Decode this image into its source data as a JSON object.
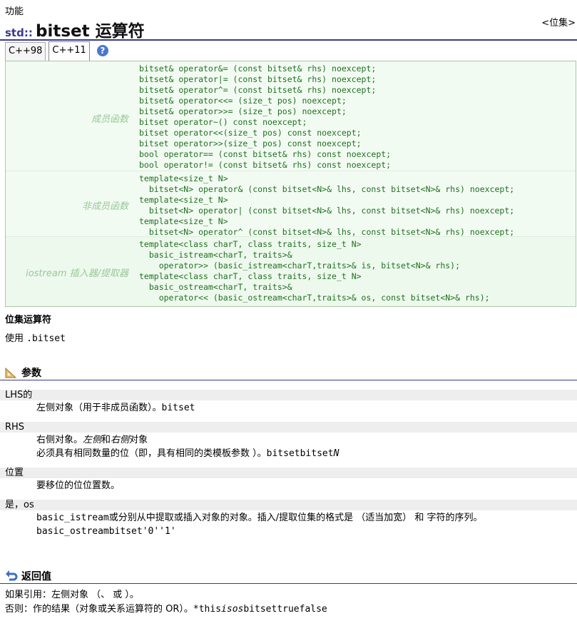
{
  "top_label": "功能",
  "header_link": "<位集>",
  "title": {
    "ns": "std::",
    "main": "bitset 运算符"
  },
  "tabs": [
    {
      "label": "C++98"
    },
    {
      "label": "C++11"
    }
  ],
  "help_icon_glyph": "?",
  "declarations": {
    "members": {
      "label": "成员函数",
      "lines": [
        "bitset& operator&= (const bitset& rhs) noexcept;",
        "bitset& operator|= (const bitset& rhs) noexcept;",
        "bitset& operator^= (const bitset& rhs) noexcept;",
        "bitset& operator<<= (size_t pos) noexcept;",
        "bitset& operator>>= (size_t pos) noexcept;",
        "bitset operator~() const noexcept;",
        "bitset operator<<(size_t pos) const noexcept;",
        "bitset operator>>(size_t pos) const noexcept;",
        "bool operator== (const bitset& rhs) const noexcept;",
        "bool operator!= (const bitset& rhs) const noexcept;"
      ]
    },
    "non_members": {
      "label": "非成员函数",
      "lines": [
        "template<size_t N>",
        "  bitset<N> operator& (const bitset<N>& lhs, const bitset<N>& rhs) noexcept;",
        "template<size_t N>",
        "  bitset<N> operator| (const bitset<N>& lhs, const bitset<N>& rhs) noexcept;",
        "template<size_t N>",
        "  bitset<N> operator^ (const bitset<N>& lhs, const bitset<N>& rhs) noexcept;"
      ]
    },
    "iostream": {
      "label": "iostream 插入器/提取器",
      "lines": [
        "template<class charT, class traits, size_t N>",
        "  basic_istream<charT, traits>&",
        "    operator>> (basic_istream<charT,traits>& is, bitset<N>& rhs);",
        "template<class charT, class traits, size_t N>",
        "  basic_ostream<charT, traits>&",
        "    operator<< (basic_ostream<charT,traits>& os, const bitset<N>& rhs);"
      ]
    }
  },
  "bitset_ops": {
    "title": "位集运算符",
    "desc_prefix": "使用 ",
    "desc_code": ".bitset"
  },
  "sections": {
    "params": "参数",
    "return": "返回值"
  },
  "params": [
    {
      "term": "LHS的",
      "desc": [
        {
          "text": "左侧对象（用于非成员函数）。",
          "code": "bitset"
        }
      ]
    },
    {
      "term": "RHS",
      "desc": [
        {
          "text_html": "右侧对象。<i>左侧</i>和<i>右侧</i>对象"
        },
        {
          "text": "必须具有相同数量的位（即，具有相同的类模板参数 ）。",
          "code": "bitsetbitset",
          "italic": "N"
        }
      ]
    },
    {
      "term": "位置",
      "desc": [
        {
          "text": "要移位的位位置数。"
        }
      ]
    },
    {
      "term": "是，os",
      "desc": [
        {
          "code_first": "basic_istream",
          "text": "或分别从中提取或插入对象的对象。插入/提取位集的格式是 （适当加宽） 和 字符的序列。"
        },
        {
          "code": "basic_ostreambitset'0''1'"
        }
      ]
    }
  ],
  "return_lines": [
    {
      "text": "如果引用：左侧对象 （、 或 ）。"
    },
    {
      "text": "否则：作的结果（对象或关系运算符的 OR）。",
      "code": "*this",
      "italic": "isos",
      "code2": "bitsettruefalse"
    }
  ]
}
